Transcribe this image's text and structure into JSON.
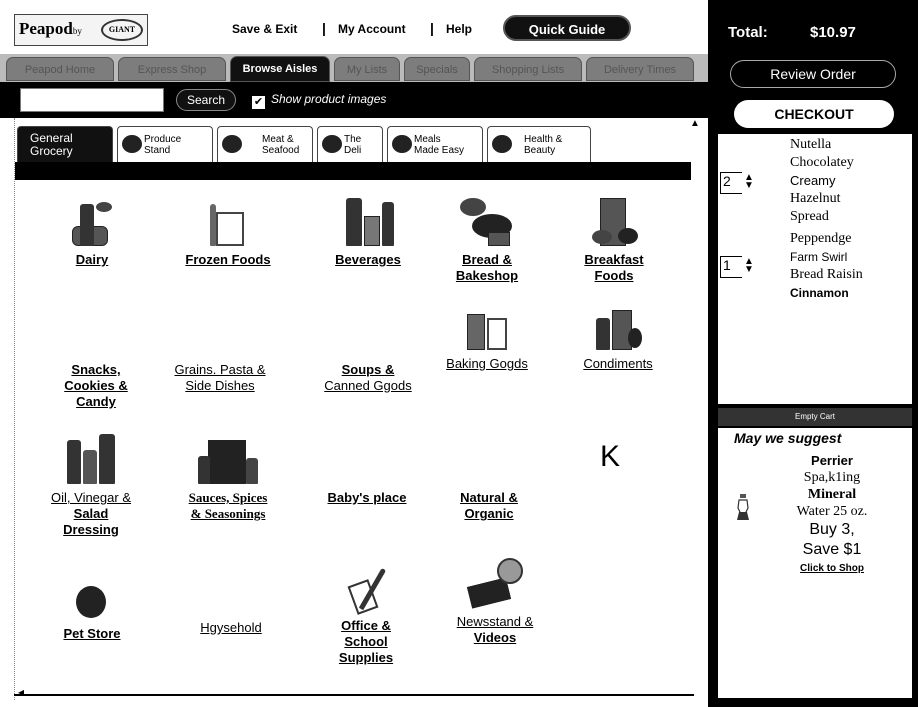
{
  "header": {
    "brand": "Peapod",
    "brand_by": "by",
    "brand_partner": "GIANT",
    "save_exit": "Save & Exit",
    "my_account": "My Account",
    "help": "Help",
    "quick_guide": "Quick Guide",
    "separator": "|"
  },
  "nav_tabs": [
    {
      "label": "Peapod Home"
    },
    {
      "label": "Express Shop"
    },
    {
      "label": "Browse Aisles"
    },
    {
      "label": "My Lists"
    },
    {
      "label": "Specials"
    },
    {
      "label": "Shopping Lists"
    },
    {
      "label": "Delivery Times"
    }
  ],
  "search": {
    "value": "",
    "button_label": "Search",
    "show_images_label": "Show product images",
    "show_images_checked": "✔"
  },
  "category_tabs": [
    {
      "label_1": "General",
      "label_2": "Grocery"
    },
    {
      "label_1": "Produce",
      "label_2": "Stand"
    },
    {
      "label_1": "Meat &",
      "label_2": "Seafood"
    },
    {
      "label_1": "The",
      "label_2": "Deli"
    },
    {
      "label_1": "Meals",
      "label_2": "Made Easy"
    },
    {
      "label_1": "Health &",
      "label_2": "Beauty"
    }
  ],
  "aisles": [
    {
      "line1": "Dairy",
      "line2": ""
    },
    {
      "line1": "Frozen Foods",
      "line2": ""
    },
    {
      "line1": "Beverages",
      "line2": ""
    },
    {
      "line1": "Bread &",
      "line2": "Bakeshop"
    },
    {
      "line1": "Breakfast",
      "line2": "Foods"
    },
    {
      "line1": "Snacks,",
      "line2": "Cookies &",
      "line3": "Candy"
    },
    {
      "line1": "Grains. Pasta &",
      "line2": "Side Dishes"
    },
    {
      "line1": "Soups &",
      "line2": "Canned Ggods"
    },
    {
      "line1": "Baking Gogds",
      "line2": ""
    },
    {
      "line1": "Condiments",
      "line2": ""
    },
    {
      "line1": "Oil, Vinegar &",
      "line2": "Salad",
      "line3": "Dressing"
    },
    {
      "line1": "Sauces, Spices",
      "line2": "& Seasonings"
    },
    {
      "line1": "Baby's place",
      "line2": ""
    },
    {
      "line1": "Natural &",
      "line2": "Organic"
    },
    {
      "line1": "Pet Store",
      "line2": ""
    },
    {
      "line1": "Hgysehold",
      "line2": ""
    },
    {
      "line1": "Office &",
      "line2": "School",
      "line3": "Supplies"
    },
    {
      "line1": "Newsstand &",
      "line2": "Videos"
    }
  ],
  "stray_mark": "K",
  "cart": {
    "total_label": "Total:",
    "total_value": "$10.97",
    "review_order": "Review Order",
    "checkout": "CHECKOUT",
    "items": [
      {
        "qty": "2",
        "name_lines": [
          "Nutella",
          "Chocolatey",
          "Creamy",
          "Hazelnut",
          "Spread"
        ]
      },
      {
        "qty": "1",
        "name_lines": [
          "Peppendge",
          "Farm Swirl",
          "Bread Raisin",
          "Cinnamon"
        ]
      }
    ],
    "empty_cart": "Empty Cart"
  },
  "suggestion": {
    "title": "May we suggest",
    "product_name": "Perrier",
    "desc1": "Spa,k1ing",
    "desc2": "Mineral",
    "desc3": "Water 25 oz.",
    "promo1": "Buy 3,",
    "promo2": "Save $1",
    "shop_link": "Click to Shop"
  },
  "colors": {
    "cart_bg": "#000000",
    "tab_active": "#111111",
    "tab_inactive": "#7d7d7d"
  }
}
